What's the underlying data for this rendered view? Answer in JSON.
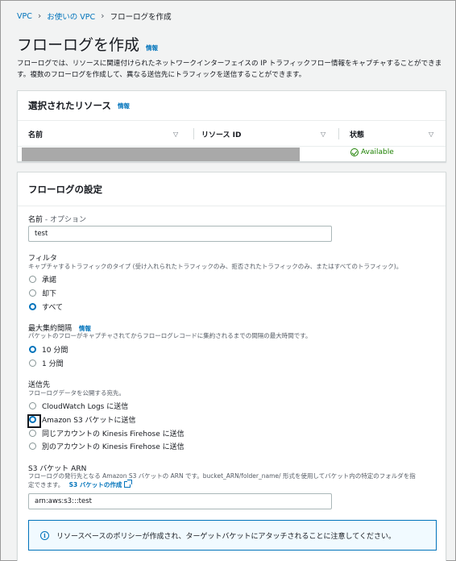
{
  "breadcrumb": {
    "items": [
      "VPC",
      "お使いの VPC"
    ],
    "current": "フローログを作成"
  },
  "page": {
    "title": "フローログを作成",
    "info": "情報",
    "description": "フローログでは、リソースに関連付けられたネットワークインターフェイスの IP トラフィックフロー情報をキャプチャすることができます。複数のフローログを作成して、異なる送信先にトラフィックを送信することができます。"
  },
  "resources": {
    "title": "選択されたリソース",
    "info": "情報",
    "columns": [
      "名前",
      "リソース ID",
      "状態"
    ],
    "rows": [
      {
        "name": "",
        "resource_id": "",
        "status": "Available"
      }
    ],
    "status_color": "#1d8102"
  },
  "settings": {
    "title": "フローログの設定",
    "name_label": "名前",
    "name_optional": " - オプション",
    "name_value": "test",
    "filter": {
      "label": "フィルタ",
      "description": "キャプチャするトラフィックのタイプ (受け入れられたトラフィックのみ、拒否されたトラフィックのみ、またはすべてのトラフィック)。",
      "options": [
        "承諾",
        "却下",
        "すべて"
      ],
      "selected": 2
    },
    "aggregation": {
      "label": "最大集約間隔",
      "info": "情報",
      "description": "パケットのフローがキャプチャされてからフローログレコードに集約されるまでの間隔の最大時間です。",
      "options": [
        "10 分間",
        "1 分間"
      ],
      "selected": 0
    },
    "destination": {
      "label": "送信先",
      "description": "フローログデータを公開する宛先。",
      "options": [
        "CloudWatch Logs に送信",
        "Amazon S3 バケットに送信",
        "同じアカウントの Kinesis Firehose に送信",
        "別のアカウントの Kinesis Firehose に送信"
      ],
      "selected": 1
    },
    "s3": {
      "label": "S3 バケット ARN",
      "description_line1": "フローログの発行先となる Amazon S3 バケットの ARN です。bucket_ARN/folder_name/ 形式を使用してバケット内の特定のフォルダを指",
      "description_line2": "定できます。",
      "create_link": "S3 バケットの作成",
      "value": "arn:aws:s3:::test"
    },
    "alert": "リソースベースのポリシーが作成され、ターゲットバケットにアタッチされることに注意してください。"
  },
  "colors": {
    "link": "#0073bb",
    "background": "#f2f3f3"
  }
}
